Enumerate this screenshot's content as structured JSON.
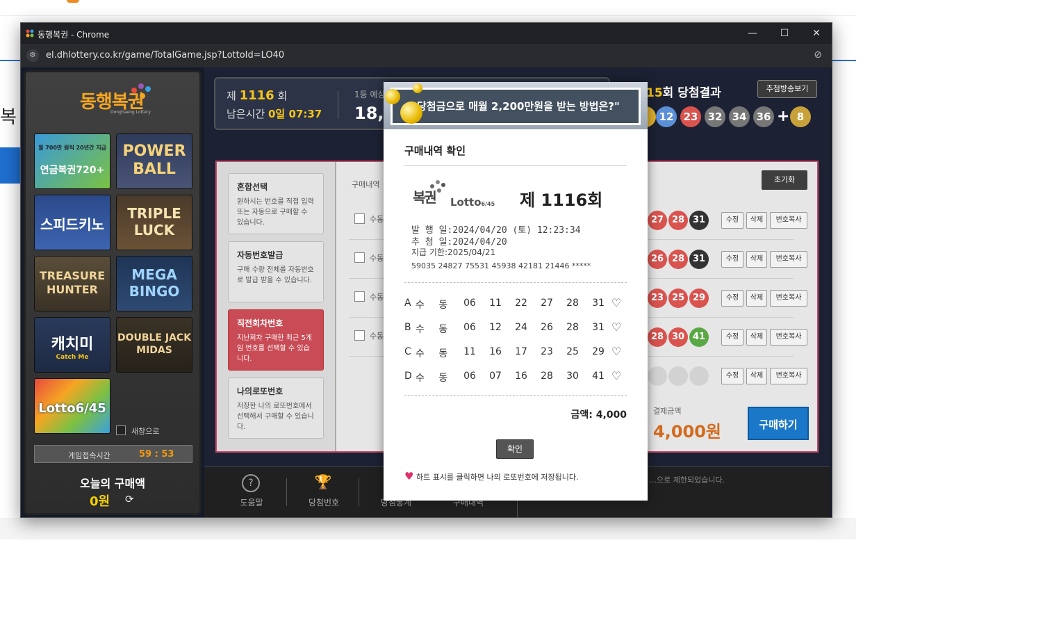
{
  "window": {
    "title": "동행복권 - Chrome",
    "url": "el.dhlottery.co.kr/game/TotalGame.jsp?LottoId=LO40",
    "minimize": "—",
    "maximize": "☐",
    "close": "✕"
  },
  "background_page": {
    "fragment_text": "복"
  },
  "sidebar": {
    "logo": "동행복권",
    "logo_sub": "Donghaeng Lottery",
    "tiles": [
      {
        "name": "pension-720",
        "label": "연금복권720+",
        "sub": "월 700만 원씩 20년간 지급"
      },
      {
        "name": "powerball",
        "label": "POWER BALL"
      },
      {
        "name": "speedkeno",
        "label": "스피드키노"
      },
      {
        "name": "triple-luck",
        "label": "TRIPLE LUCK"
      },
      {
        "name": "treasure-hunter",
        "label": "TREASURE HUNTER"
      },
      {
        "name": "mega-bingo",
        "label": "MEGA BINGO"
      },
      {
        "name": "catch-me",
        "label": "캐치미",
        "sub": "Catch Me"
      },
      {
        "name": "double-jack-midas",
        "label": "DOUBLE JACK MIDAS"
      },
      {
        "name": "lotto645",
        "label": "Lotto6/45"
      }
    ],
    "new_window_label": "새창으로",
    "timer_label": "게임접속시간",
    "timer_value": "59 : 53",
    "today_label": "오늘의 구매액",
    "today_amount": "0원"
  },
  "game": {
    "draw_prefix": "제",
    "draw_no": "1116",
    "draw_suffix": "회",
    "remain_label": "남은시간",
    "remain_value": "0일 07:37",
    "first_prize_label": "1등 예상",
    "first_prize_value": "18,7",
    "result_title_num": "15",
    "result_title_text": "회 당첨결과",
    "replay_button": "추첨방송보기",
    "win_balls": [
      {
        "n": "",
        "color": "#e0b030"
      },
      {
        "n": "12",
        "color": "#5b8fd6"
      },
      {
        "n": "23",
        "color": "#d9534f"
      },
      {
        "n": "32",
        "color": "#777777"
      },
      {
        "n": "34",
        "color": "#777777"
      },
      {
        "n": "36",
        "color": "#777777"
      }
    ],
    "bonus_ball": "8",
    "plus": "+",
    "menu": [
      {
        "title": "혼합선택",
        "desc": "원하시는 번호를 직접 입력 또는 자동으로 구매할 수 있습니다."
      },
      {
        "title": "자동번호발급",
        "desc": "구매 수량 전체를 자동번호로 발급 받을 수 있습니다."
      },
      {
        "title": "직전회차번호",
        "desc": "지난회차 구매한 최근 5게임 번호를 선택할 수 있습니다."
      },
      {
        "title": "나의로또번호",
        "desc": "저장한 나의 로또번호에서 선택해서 구매할 수 있습니다."
      }
    ],
    "slot_header": "구매내역",
    "reset_button": "초기화",
    "slot_label": "수동",
    "slots": [
      {
        "balls": [
          "27",
          "28",
          "31"
        ]
      },
      {
        "balls": [
          "26",
          "28",
          "31"
        ]
      },
      {
        "balls": [
          "23",
          "25",
          "29"
        ]
      },
      {
        "balls": [
          "28",
          "30",
          "41"
        ]
      },
      {
        "balls": [
          "",
          "",
          ""
        ]
      }
    ],
    "slot_buttons": {
      "edit": "수정",
      "delete": "삭제",
      "copy": "번호복사"
    },
    "pay_label": "결제금액",
    "pay_value": "4,000원",
    "buy_button": "구매하기",
    "bottom": [
      {
        "label": "도움말",
        "icon": "?"
      },
      {
        "label": "당첨번호",
        "icon": "🏆"
      },
      {
        "label": "당첨통계",
        "icon": ""
      },
      {
        "label": "구매내역",
        "icon": ""
      }
    ],
    "bottom_note": "…으로 제한되었습니다."
  },
  "modal": {
    "banner": "\"당첨금으로 매월 2,200만원을 받는 방법은?\"",
    "title": "구매내역 확인",
    "logo_text": "복권",
    "logo_lotto": "Lotto",
    "logo_lotto_sub": "6/45",
    "draw": "제 1116회",
    "issue_label": "발 행 일",
    "issue_value": "2024/04/20 (토) 12:23:34",
    "draw_date_label": "추 첨 일",
    "draw_date_value": "2024/04/20",
    "deadline_label": "지급 기한",
    "deadline_value": "2025/04/21",
    "serial": "59035 24827 75531 45938 42181 21446 *****",
    "rows": [
      {
        "letter": "A",
        "mode": "수 동",
        "nums": [
          "06",
          "11",
          "22",
          "27",
          "28",
          "31"
        ]
      },
      {
        "letter": "B",
        "mode": "수 동",
        "nums": [
          "06",
          "12",
          "24",
          "26",
          "28",
          "31"
        ]
      },
      {
        "letter": "C",
        "mode": "수 동",
        "nums": [
          "11",
          "16",
          "17",
          "23",
          "25",
          "29"
        ]
      },
      {
        "letter": "D",
        "mode": "수 동",
        "nums": [
          "06",
          "07",
          "16",
          "28",
          "30",
          "41"
        ]
      }
    ],
    "heart": "♡",
    "amount": "금액: 4,000",
    "ok_button": "확인",
    "note": "하트 표시를 클릭하면 나의 로또번호에 저장됩니다.",
    "note_heart": "♥"
  },
  "colors": {
    "accent_gold": "#f5c518",
    "buy_blue": "#1b78c8",
    "active_red": "#c84b55",
    "heart_pink": "#e0306a"
  }
}
